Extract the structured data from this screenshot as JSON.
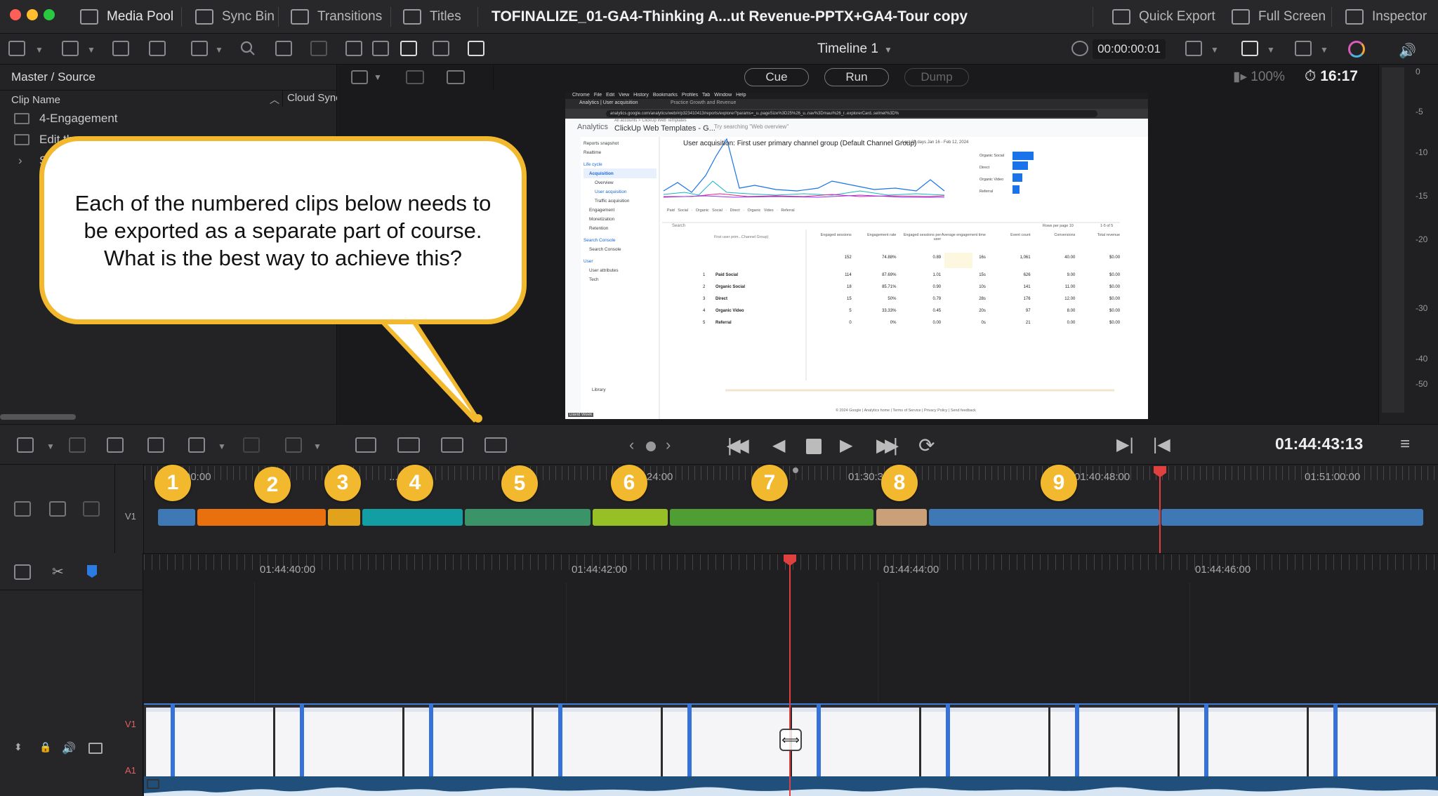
{
  "topbar": {
    "media_pool": "Media Pool",
    "sync_bin": "Sync Bin",
    "transitions": "Transitions",
    "titles": "Titles",
    "project_title": "TOFINALIZE_01-GA4-Thinking A...ut Revenue-PPTX+GA4-Tour copy",
    "quick_export": "Quick Export",
    "full_screen": "Full Screen",
    "inspector": "Inspector"
  },
  "toolbar": {
    "timeline_name": "Timeline 1",
    "timecode": "00:00:00:01"
  },
  "left_panel": {
    "breadcrumb": "Master / Source",
    "col_clip_name": "Clip Name",
    "col_cloud_sync": "Cloud Sync",
    "items": [
      {
        "label": "4-Engagement"
      },
      {
        "label": "Edit th"
      },
      {
        "label": "S"
      }
    ]
  },
  "viewer": {
    "cue": "Cue",
    "run": "Run",
    "dump": "Dump",
    "zoom": "100%",
    "time": "16:17",
    "meter_labels": [
      "0",
      "-5",
      "-10",
      "-15",
      "-20",
      "-30",
      "-40",
      "-50"
    ]
  },
  "screen": {
    "menubar": [
      "Chrome",
      "File",
      "Edit",
      "View",
      "History",
      "Bookmarks",
      "Profiles",
      "Tab",
      "Window",
      "Help"
    ],
    "tab1": "Analytics | User acquisition",
    "tab2": "Practice Growth and Revenue",
    "url": "analytics.google.com/analytics/web/#/p323410413/reports/explorer?params=_u..pageSize%3D25%26_u..nav%3Dmaui%26_r..explorerCard..selmet%3D%",
    "app_name": "Analytics",
    "account_path": "All accounts > ClickUp Web Templates",
    "property": "ClickUp Web Templates - G...",
    "search_ph": "Try searching \"Web overview\"",
    "report_title": "User acquisition: First user primary channel group (Default Channel Group)",
    "date_range": "Last 28 days  Jan 16 - Feb 12, 2024",
    "nav": [
      "Reports snapshot",
      "Realtime",
      "Life cycle",
      "Acquisition",
      "Overview",
      "User acquisition",
      "Traffic acquisition",
      "Engagement",
      "Monetization",
      "Retention",
      "Search Console",
      "Search Console",
      "User",
      "User attributes",
      "Tech"
    ],
    "library": "Library",
    "bar_labels": [
      "Organic Social",
      "Direct",
      "Organic Video",
      "Referral"
    ],
    "legend": [
      "Paid Social",
      "Organic Social",
      "Direct",
      "Organic Video",
      "Referral"
    ],
    "table_search": "Search",
    "rows_per_page": "Rows per page  10",
    "pager": "1-5 of 5",
    "dim_header": "First user prim...Channel Group)",
    "headers": [
      "Engaged sessions",
      "Engagement rate",
      "Engaged sessions per user",
      "Average engagement time",
      "Event count",
      "Conversions",
      "Total revenue"
    ],
    "totals": [
      "152",
      "74.88%",
      "0.89",
      "16s",
      "1,061",
      "40.00",
      "$0.00"
    ],
    "rows": [
      {
        "i": "1",
        "name": "Paid Social",
        "v": [
          "114",
          "87.69%",
          "1.01",
          "15s",
          "626",
          "9.00",
          "$0.00"
        ]
      },
      {
        "i": "2",
        "name": "Organic Social",
        "v": [
          "18",
          "85.71%",
          "0.90",
          "10s",
          "141",
          "11.00",
          "$0.00"
        ]
      },
      {
        "i": "3",
        "name": "Direct",
        "v": [
          "15",
          "50%",
          "0.79",
          "28s",
          "176",
          "12.00",
          "$0.00"
        ]
      },
      {
        "i": "4",
        "name": "Organic Video",
        "v": [
          "5",
          "33.33%",
          "0.45",
          "20s",
          "97",
          "8.00",
          "$0.00"
        ]
      },
      {
        "i": "5",
        "name": "Referral",
        "v": [
          "0",
          "0%",
          "0.00",
          "0s",
          "21",
          "0.00",
          "$0.00"
        ]
      }
    ],
    "footer": "© 2024 Google | Analytics home | Terms of Service | Privacy Policy |  Send feedback",
    "watermark": "David Week"
  },
  "callout": {
    "text": "Each of the numbered clips below needs to be exported as a separate part of course. What is the best way to achieve this?"
  },
  "transport": {
    "record_tc": "01:44:43:13"
  },
  "upper_timeline": {
    "track": "V1",
    "ruler": [
      "00:00",
      "...00",
      "01:24:00",
      "01:30:3",
      "01:40:48:00",
      "01:51:00:00"
    ],
    "clips": [
      {
        "color": "#3f79b5"
      },
      {
        "color": "#e8700f"
      },
      {
        "color": "#e3a21c"
      },
      {
        "color": "#129ea3"
      },
      {
        "color": "#3a9468"
      },
      {
        "color": "#97c027"
      },
      {
        "color": "#4f9e33"
      },
      {
        "color": "#c9a078"
      },
      {
        "color": "#3f79b5"
      },
      {
        "color": "#3f79b5"
      }
    ],
    "markers": [
      "1",
      "2",
      "3",
      "4",
      "5",
      "6",
      "7",
      "8",
      "9"
    ]
  },
  "lower_timeline": {
    "ruler": [
      "01:44:40:00",
      "01:44:42:00",
      "01:44:44:00",
      "01:44:46:00"
    ],
    "tracks": [
      "V1",
      "A1"
    ]
  }
}
